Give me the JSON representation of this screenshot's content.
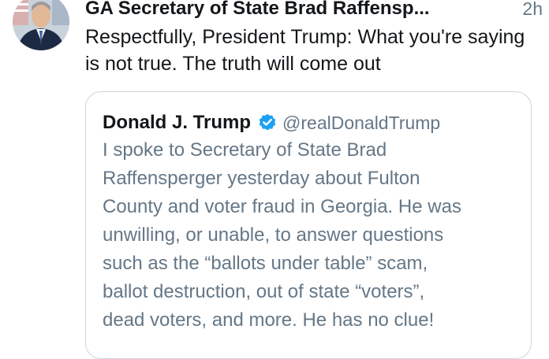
{
  "tweet": {
    "author_name": "GA Secretary of State Brad Raffensp...",
    "timestamp": "2h",
    "text": "Respectfully, President Trump: What you're saying is not true. The truth will come out",
    "avatar_icon": "profile-photo",
    "quoted": {
      "name": "Donald J. Trump",
      "verified_icon": "verified-badge-icon",
      "handle": "@realDonaldTrump",
      "text": "I spoke to Secretary of State Brad\nRaffensperger yesterday about Fulton\nCounty and voter fraud in Georgia. He was\nunwilling, or unable, to answer questions\nsuch as the “ballots under table” scam,\nballot destruction, out of state “voters”,\ndead voters, and more. He has no clue!"
    }
  },
  "colors": {
    "primary_text": "#14171a",
    "secondary_text": "#657786",
    "verified_blue": "#1da1f2",
    "border": "#ccd6dd"
  }
}
